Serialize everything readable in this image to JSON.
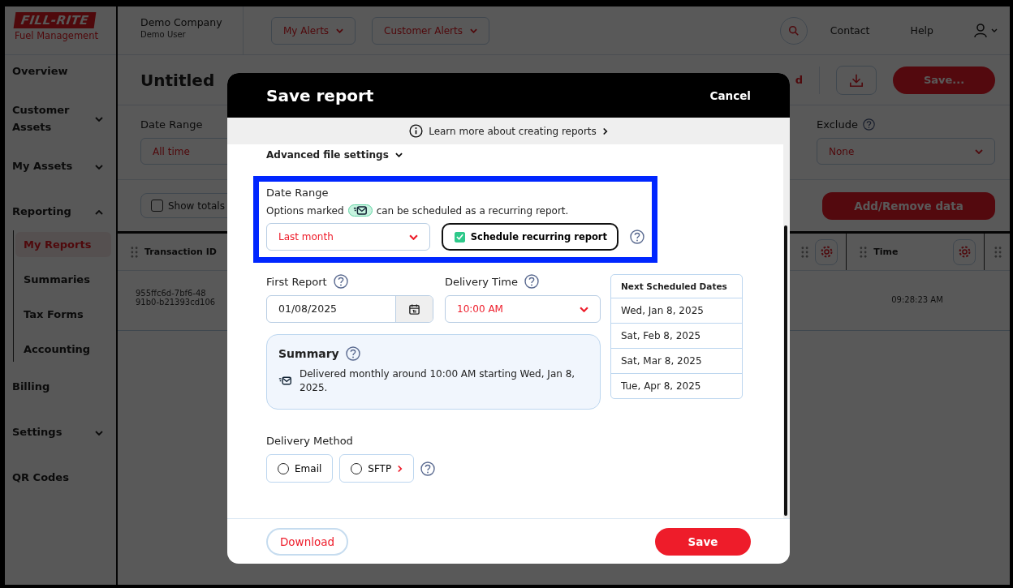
{
  "header": {
    "logo": {
      "brand": "FILL-RITE",
      "subtitle": "Fuel Management"
    },
    "company": "Demo Company",
    "user": "Demo User",
    "alert_buttons": [
      "My Alerts",
      "Customer Alerts"
    ],
    "links": [
      "Contact",
      "Help"
    ]
  },
  "sidebar": {
    "items": [
      {
        "label": "Overview",
        "kind": "link"
      },
      {
        "label": "Customer Assets",
        "kind": "group",
        "expanded": false
      },
      {
        "label": "My Assets",
        "kind": "group",
        "expanded": false
      },
      {
        "label": "Reporting",
        "kind": "group",
        "expanded": true,
        "children": [
          {
            "label": "My Reports",
            "selected": true
          },
          {
            "label": "Summaries",
            "selected": false
          },
          {
            "label": "Tax Forms",
            "selected": false
          },
          {
            "label": "Accounting",
            "selected": false
          }
        ]
      },
      {
        "label": "Billing",
        "kind": "link"
      },
      {
        "label": "Settings",
        "kind": "group",
        "expanded": false
      },
      {
        "label": "QR Codes",
        "kind": "link"
      }
    ]
  },
  "report": {
    "title": "Untitled",
    "link_fragment": "d",
    "save_button": "Save...",
    "filters": [
      {
        "label": "Date Range",
        "value": "All time",
        "help": false
      },
      {
        "label": "Exclude",
        "value": "None",
        "help": true
      }
    ],
    "show_totals": {
      "label": "Show totals",
      "checked": false
    },
    "add_remove_button": "Add/Remove data",
    "table": {
      "columns": [
        {
          "label": "Transaction ID",
          "kind": "plain"
        },
        {
          "kind": "gear"
        },
        {
          "label": "Time",
          "kind": "gear"
        },
        {
          "kind": "drag"
        }
      ],
      "rows": [
        {
          "transaction_id": [
            "955ffc6d-7bf6-48",
            "91b0-b21393cd106"
          ],
          "time": "09:28:23 AM"
        }
      ]
    }
  },
  "modal": {
    "title": "Save report",
    "cancel": "Cancel",
    "info_link": "Learn more about creating reports",
    "advanced_toggle": "Advanced file settings",
    "date_range": {
      "highlighted": true,
      "label": "Date Range",
      "hint_before": "Options marked",
      "hint_after": "can be scheduled as a recurring report.",
      "value": "Last month",
      "schedule": {
        "label": "Schedule recurring report",
        "checked": true
      }
    },
    "first_report": {
      "label": "First Report",
      "value": "01/08/2025"
    },
    "delivery_time": {
      "label": "Delivery Time",
      "value": "10:00 AM"
    },
    "next_dates": {
      "title": "Next Scheduled Dates",
      "dates": [
        "Wed, Jan 8, 2025",
        "Sat, Feb 8, 2025",
        "Sat, Mar 8, 2025",
        "Tue, Apr 8, 2025"
      ]
    },
    "summary": {
      "title": "Summary",
      "text": "Delivered monthly around 10:00 AM starting Wed, Jan 8, 2025."
    },
    "delivery_method": {
      "label": "Delivery Method",
      "options": [
        {
          "label": "Email",
          "selected": false,
          "kind": "plain"
        },
        {
          "label": "SFTP",
          "selected": false,
          "kind": "configurable"
        }
      ]
    },
    "footer": {
      "download": "Download",
      "save": "Save"
    }
  }
}
